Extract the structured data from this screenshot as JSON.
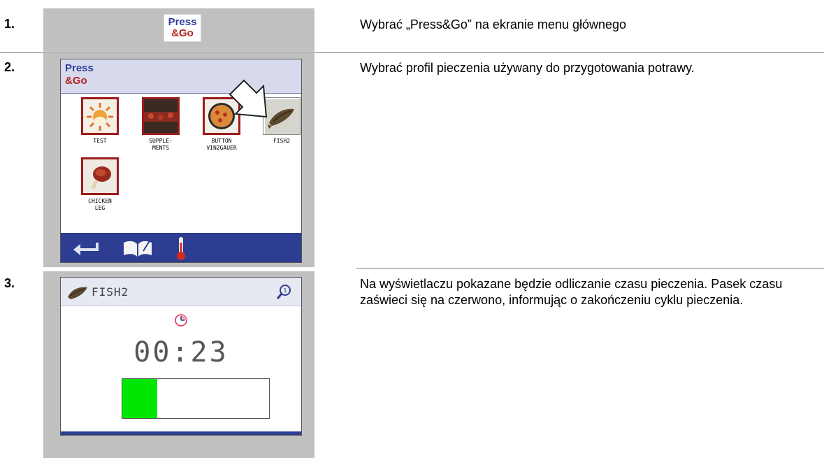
{
  "steps": [
    {
      "number": "1.",
      "text": "Wybrać „Press&Go” na ekranie menu głównego"
    },
    {
      "number": "2.",
      "text": "Wybrać profil pieczenia używany do przygotowania potrawy."
    },
    {
      "number": "3.",
      "text": "Na wyświetlaczu pokazane będzie odliczanie czasu pieczenia. Pasek czasu zaświeci się na czerwono, informując o zakończeniu cyklu pieczenia."
    }
  ],
  "logo": {
    "line1": "Press",
    "line2": "&Go"
  },
  "menu_screen": {
    "logo_line1": "Press",
    "logo_line2": "&Go",
    "tiles": [
      {
        "label1": "TEST",
        "label2": ""
      },
      {
        "label1": "SUPPLE-",
        "label2": "MENTS"
      },
      {
        "label1": "BUTTON",
        "label2": "VINZGAUER"
      },
      {
        "label1": "FISH2",
        "label2": ""
      },
      {
        "label1": "CHICKEN",
        "label2": "LEG"
      }
    ],
    "footer_icons": [
      "back-arrow-icon",
      "recipe-book-icon",
      "thermometer-icon"
    ]
  },
  "timer_screen": {
    "title": "FISH2",
    "time": "00:23",
    "progress": 0.24,
    "colors": {
      "progress": "#00e600",
      "footer": "#2d3d92",
      "cancel": "#e02020"
    }
  }
}
